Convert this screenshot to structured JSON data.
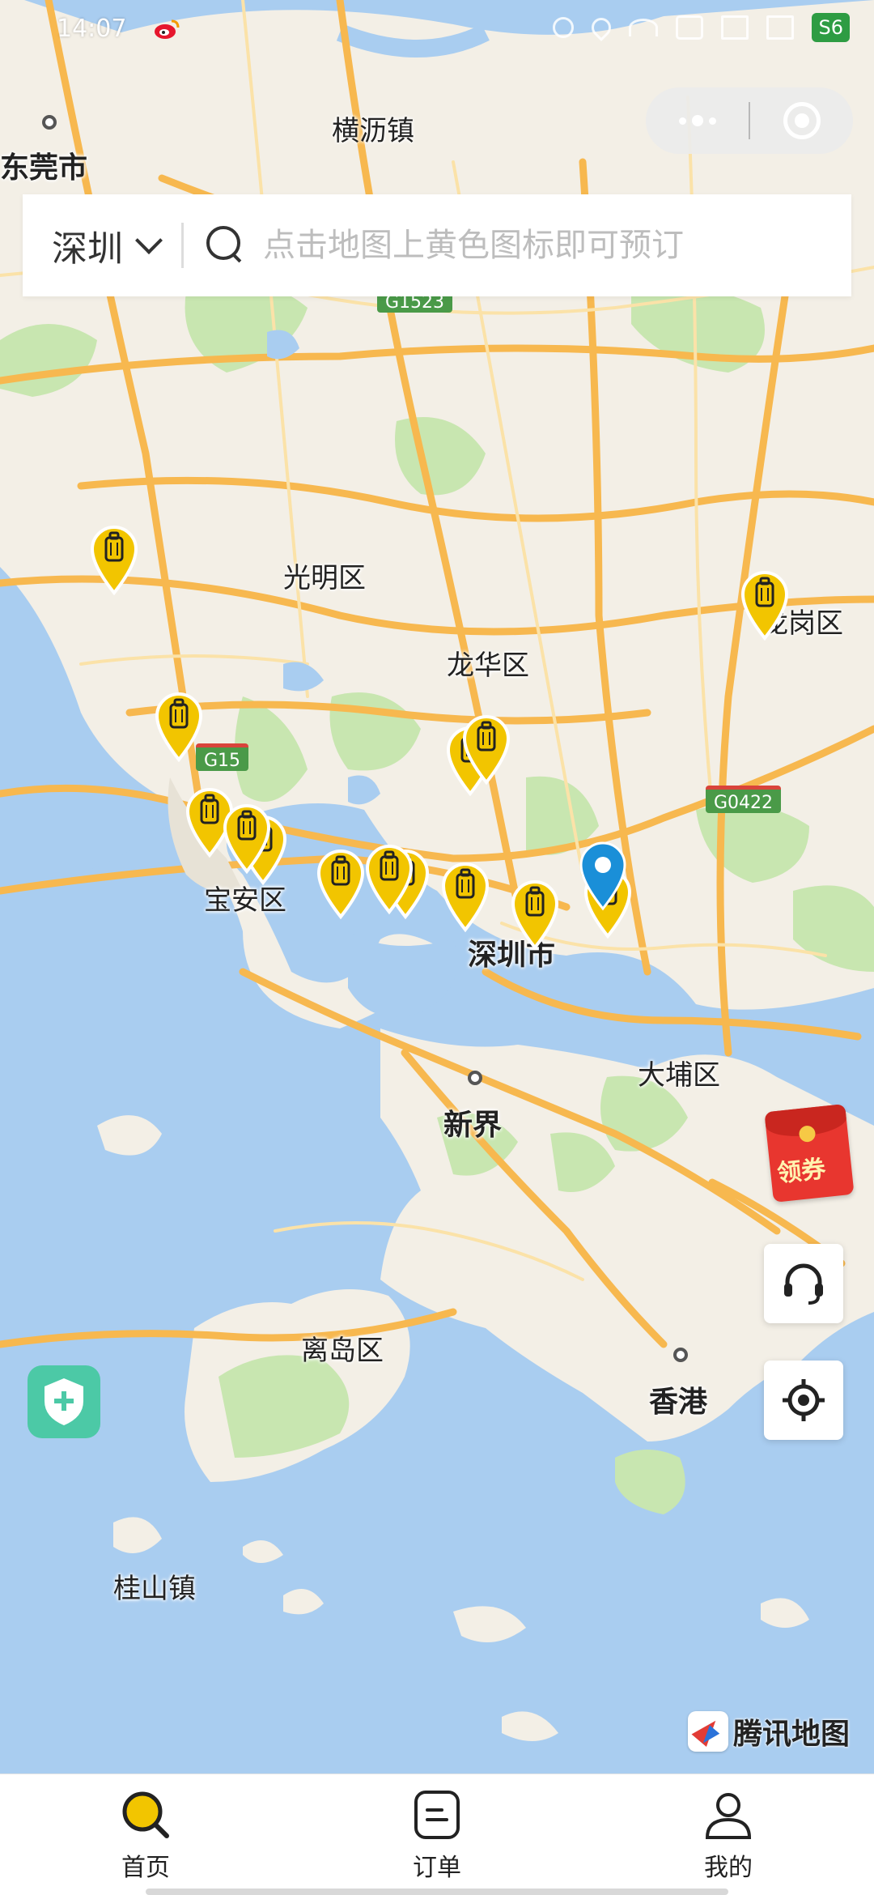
{
  "status_bar": {
    "time": "14:07",
    "battery": "S6",
    "icons": [
      "weibo-icon",
      "nfc-icon",
      "location-icon",
      "wifi-icon",
      "hd-icon",
      "signal-icon",
      "signal-icon",
      "battery-icon"
    ]
  },
  "capsule": {
    "menu_icon": "more-dots-icon",
    "close_icon": "target-close-icon"
  },
  "search": {
    "city": "深圳",
    "placeholder": "点击地图上黄色图标即可预订"
  },
  "map": {
    "places": {
      "dongguan": "东莞市",
      "hengli": "横沥镇",
      "guangming": "光明区",
      "longhua": "龙华区",
      "longgang": "龙岗区",
      "baoan": "宝安区",
      "shenzhen": "深圳市",
      "xinjie": "新界",
      "dapu": "大埔区",
      "lidao": "离岛区",
      "xianggang": "香港",
      "guishan": "桂山镇"
    },
    "highways": {
      "g1523": "G1523",
      "g15": "G15",
      "g0422": "G0422"
    },
    "provider": "腾讯地图",
    "pin_icon": "luggage-locker-pin-icon",
    "current_location_icon": "current-location-pin-icon"
  },
  "floating": {
    "coupon_label": "领券",
    "service_icon": "headset-icon",
    "locate_icon": "locate-icon",
    "shield_icon": "shield-plus-icon"
  },
  "tabs": [
    {
      "label": "首页",
      "icon": "search-icon",
      "active": true
    },
    {
      "label": "订单",
      "icon": "order-list-icon",
      "active": false
    },
    {
      "label": "我的",
      "icon": "profile-icon",
      "active": false
    }
  ],
  "colors": {
    "pin_yellow": "#f2c500",
    "current_blue": "#1a8fd8",
    "water": "#a9cdf0",
    "land": "#f3efe6",
    "green": "#c8e6b0",
    "road": "#f7b84f"
  }
}
